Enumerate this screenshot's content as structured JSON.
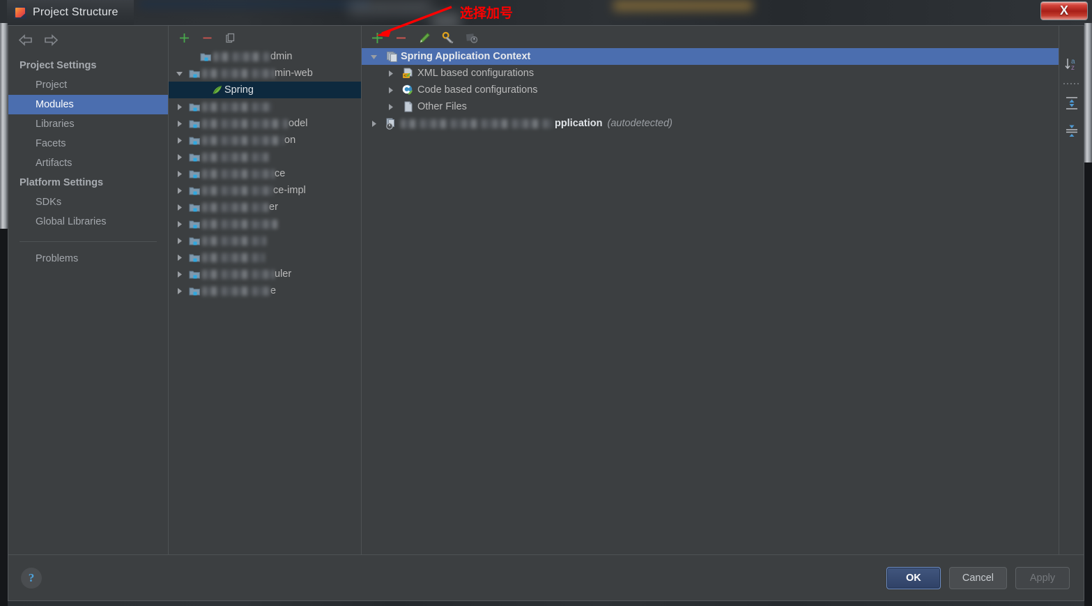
{
  "window": {
    "title": "Project Structure",
    "app_icon": "intellij-idea-icon",
    "close_label": "X"
  },
  "annotation": {
    "text": "选择加号",
    "color": "#ff0000",
    "points_to": "add-facet-button"
  },
  "sidebar": {
    "back_icon": "arrow-left-icon",
    "forward_icon": "arrow-right-icon",
    "groups": [
      {
        "title": "Project Settings",
        "items": [
          {
            "label": "Project",
            "selected": false
          },
          {
            "label": "Modules",
            "selected": true
          },
          {
            "label": "Libraries",
            "selected": false
          },
          {
            "label": "Facets",
            "selected": false
          },
          {
            "label": "Artifacts",
            "selected": false
          }
        ]
      },
      {
        "title": "Platform Settings",
        "items": [
          {
            "label": "SDKs",
            "selected": false
          },
          {
            "label": "Global Libraries",
            "selected": false
          }
        ]
      }
    ],
    "problems_label": "Problems"
  },
  "modules_panel": {
    "toolbar": [
      {
        "name": "add-module-button",
        "icon": "plus-icon",
        "color": "#49a84c"
      },
      {
        "name": "remove-module-button",
        "icon": "minus-icon",
        "color": "#c75450"
      },
      {
        "name": "copy-module-button",
        "icon": "copy-icon",
        "color": "#8a8e93"
      }
    ],
    "rows": [
      {
        "indent": 1,
        "twisty": "none",
        "icon": "module-icon",
        "redacted": true,
        "redact_width": 82,
        "suffix": "dmin",
        "selected": false
      },
      {
        "indent": 0,
        "twisty": "expanded",
        "icon": "module-icon",
        "redacted": true,
        "redact_width": 104,
        "suffix": "min-web",
        "selected": false
      },
      {
        "indent": 2,
        "twisty": "none",
        "icon": "spring-leaf-icon",
        "redacted": false,
        "label": "Spring",
        "selected": true
      },
      {
        "indent": 0,
        "twisty": "collapsed",
        "icon": "module-icon",
        "redacted": true,
        "redact_width": 100,
        "suffix": "",
        "selected": false
      },
      {
        "indent": 0,
        "twisty": "collapsed",
        "icon": "module-icon",
        "redacted": true,
        "redact_width": 124,
        "suffix": "odel",
        "selected": false
      },
      {
        "indent": 0,
        "twisty": "collapsed",
        "icon": "module-icon",
        "redacted": true,
        "redact_width": 118,
        "suffix": "on",
        "selected": false
      },
      {
        "indent": 0,
        "twisty": "collapsed",
        "icon": "module-icon",
        "redacted": true,
        "redact_width": 96,
        "suffix": "",
        "selected": false
      },
      {
        "indent": 0,
        "twisty": "collapsed",
        "icon": "module-icon",
        "redacted": true,
        "redact_width": 104,
        "suffix": "ce",
        "selected": false
      },
      {
        "indent": 0,
        "twisty": "collapsed",
        "icon": "module-icon",
        "redacted": true,
        "redact_width": 102,
        "suffix": "ce-impl",
        "selected": false
      },
      {
        "indent": 0,
        "twisty": "collapsed",
        "icon": "module-icon",
        "redacted": true,
        "redact_width": 96,
        "suffix": "er",
        "selected": false
      },
      {
        "indent": 0,
        "twisty": "collapsed",
        "icon": "module-icon",
        "redacted": true,
        "redact_width": 108,
        "suffix": "",
        "selected": false
      },
      {
        "indent": 0,
        "twisty": "collapsed",
        "icon": "module-icon",
        "redacted": true,
        "redact_width": 92,
        "suffix": "",
        "selected": false
      },
      {
        "indent": 0,
        "twisty": "collapsed",
        "icon": "module-icon",
        "redacted": true,
        "redact_width": 90,
        "suffix": "",
        "selected": false
      },
      {
        "indent": 0,
        "twisty": "collapsed",
        "icon": "module-icon",
        "redacted": true,
        "redact_width": 104,
        "suffix": "uler",
        "selected": false
      },
      {
        "indent": 0,
        "twisty": "collapsed",
        "icon": "module-icon",
        "redacted": true,
        "redact_width": 98,
        "suffix": "e",
        "selected": false
      }
    ]
  },
  "facet_panel": {
    "toolbar": [
      {
        "name": "add-facet-button",
        "icon": "plus-icon",
        "color": "#49a84c"
      },
      {
        "name": "remove-facet-button",
        "icon": "minus-icon",
        "color": "#c75450"
      },
      {
        "name": "edit-facet-button",
        "icon": "pencil-icon",
        "color": "#62a544"
      },
      {
        "name": "configure-facet-button",
        "icon": "wrench-icon",
        "color": "#b0b4b8"
      },
      {
        "name": "disable-facet-button",
        "icon": "power-disabled-icon",
        "color": "#6a6e73"
      }
    ],
    "rows": [
      {
        "indent": 0,
        "twisty": "expanded",
        "icon": "spring-context-icon",
        "label": "Spring Application Context",
        "selected": true,
        "redacted": false,
        "note": ""
      },
      {
        "indent": 1,
        "twisty": "collapsed",
        "icon": "xml-config-icon",
        "label": "XML based configurations",
        "selected": false,
        "redacted": false,
        "note": ""
      },
      {
        "indent": 1,
        "twisty": "collapsed",
        "icon": "code-config-icon",
        "label": "Code based configurations",
        "selected": false,
        "redacted": false,
        "note": ""
      },
      {
        "indent": 1,
        "twisty": "collapsed",
        "icon": "file-icon",
        "label": "Other Files",
        "selected": false,
        "redacted": false,
        "note": ""
      },
      {
        "indent": 0,
        "twisty": "collapsed",
        "icon": "autodetected-icon",
        "label": "pplication",
        "selected": false,
        "redacted": true,
        "redact_width": 218,
        "note": "(autodetected)"
      }
    ]
  },
  "side_actions": [
    {
      "name": "sort-alphabetically-button",
      "icon": "sort-az-icon"
    },
    {
      "name": "expand-all-button",
      "icon": "expand-all-icon"
    },
    {
      "name": "collapse-all-button",
      "icon": "collapse-all-icon"
    }
  ],
  "footer": {
    "help_icon": "question-mark-icon",
    "ok_label": "OK",
    "cancel_label": "Cancel",
    "apply_label": "Apply"
  }
}
